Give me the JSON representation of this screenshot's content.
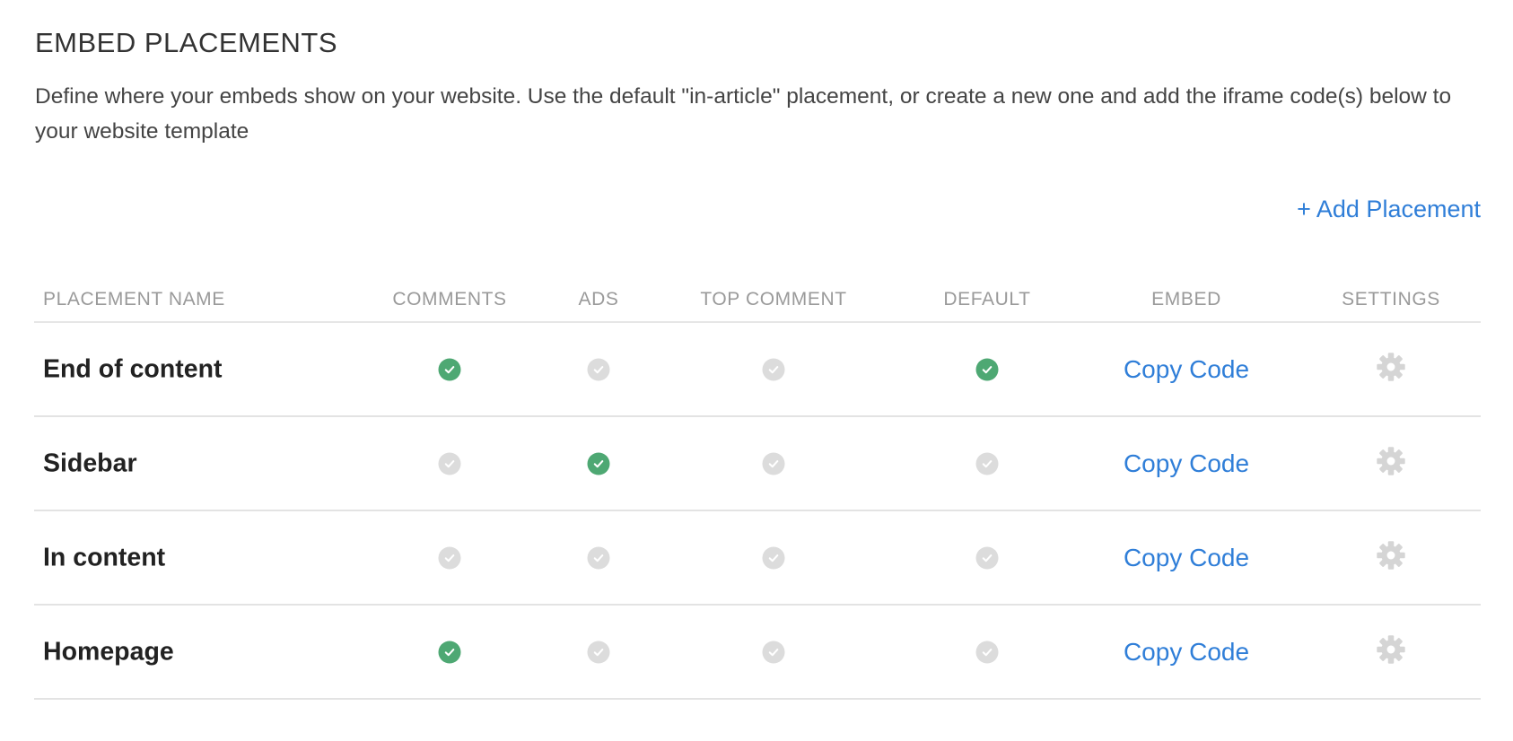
{
  "page": {
    "title": "EMBED PLACEMENTS",
    "description": "Define where your embeds show on your website. Use the default \"in-article\" placement, or create a new one and add the iframe code(s) below to your website template",
    "add_placement_label": "+ Add Placement"
  },
  "colors": {
    "accent": "#2f7ed8",
    "check_on": "#4ea873",
    "check_off": "#dcdcdc",
    "gear": "#d5d5d5"
  },
  "table": {
    "headers": {
      "name": "PLACEMENT NAME",
      "comments": "COMMENTS",
      "ads": "ADS",
      "top_comment": "TOP COMMENT",
      "default": "DEFAULT",
      "embed": "EMBED",
      "settings": "SETTINGS"
    },
    "rows": [
      {
        "name": "End of content",
        "comments": true,
        "ads": false,
        "top_comment": false,
        "default": true,
        "embed_label": "Copy Code",
        "settings_icon": "gear-icon"
      },
      {
        "name": "Sidebar",
        "comments": false,
        "ads": true,
        "top_comment": false,
        "default": false,
        "embed_label": "Copy Code",
        "settings_icon": "gear-icon"
      },
      {
        "name": "In content",
        "comments": false,
        "ads": false,
        "top_comment": false,
        "default": false,
        "embed_label": "Copy Code",
        "settings_icon": "gear-icon"
      },
      {
        "name": "Homepage",
        "comments": true,
        "ads": false,
        "top_comment": false,
        "default": false,
        "embed_label": "Copy Code",
        "settings_icon": "gear-icon"
      }
    ]
  }
}
